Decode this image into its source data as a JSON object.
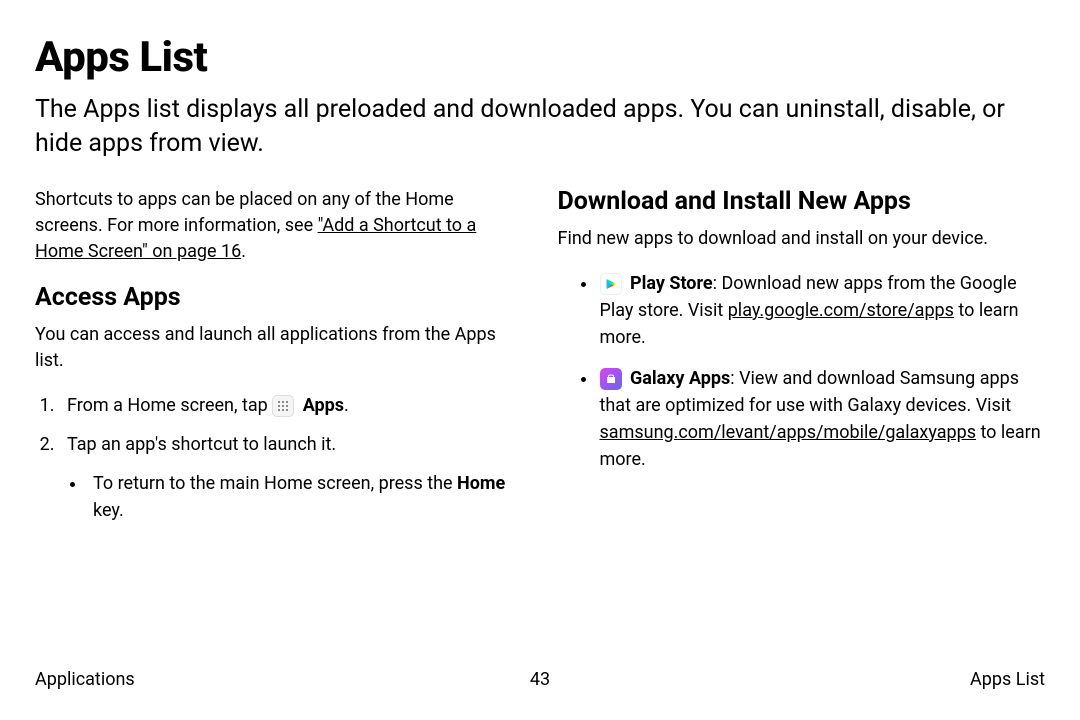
{
  "page": {
    "title": "Apps List",
    "intro": "The Apps list displays all preloaded and downloaded apps. You can uninstall, disable, or hide apps from view."
  },
  "leftColumn": {
    "shortcutsPrefix": "Shortcuts to apps can be placed on any of the Home screens. For more information, see ",
    "shortcutsLink": "\"Add a Shortcut to a Home Screen\" on page 16",
    "shortcutsSuffix": ".",
    "accessApps": {
      "heading": "Access Apps",
      "intro": "You can access and launch all applications from the Apps list.",
      "step1Prefix": "From a Home screen, tap ",
      "step1Label": "Apps",
      "step1Suffix": ".",
      "step2": "Tap an app's shortcut to launch it.",
      "step2SubPrefix": "To return to the main Home screen, press the ",
      "step2SubBold": "Home",
      "step2SubSuffix": " key."
    }
  },
  "rightColumn": {
    "heading": "Download and Install New Apps",
    "intro": "Find new apps to download and install on your device.",
    "playStore": {
      "name": "Play Store",
      "desc1": ": Download new apps from the Google Play store. Visit ",
      "link": "play.google.com/store/apps",
      "desc2": " to learn more."
    },
    "galaxyApps": {
      "name": "Galaxy Apps",
      "desc1": ": View and download Samsung apps that are optimized for use with Galaxy devices. Visit ",
      "link": "samsung.com/levant/apps/mobile/galaxyapps",
      "desc2": " to learn more."
    }
  },
  "footer": {
    "left": "Applications",
    "center": "43",
    "right": "Apps List"
  }
}
